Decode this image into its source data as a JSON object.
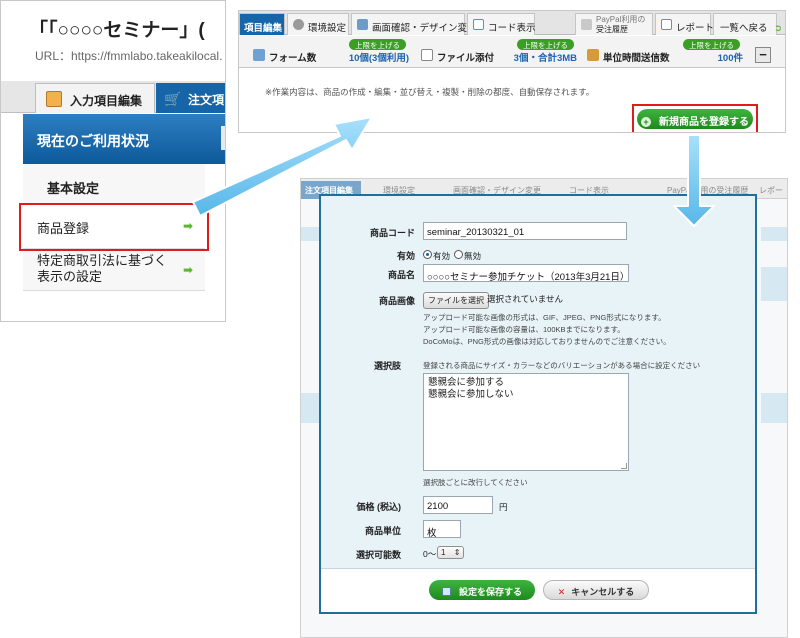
{
  "panel1": {
    "title": "「「○○○○セミナー」(",
    "url": "URL：https://fmmlabo.takeakilocal.",
    "tabs": {
      "input_edit": "入力項目編集",
      "order": "注文項"
    },
    "section_title": "現在のご利用状況",
    "menu": {
      "basic": "基本設定",
      "product": "商品登録",
      "law_line1": "特定商取引法に基づく",
      "law_line2": "表示の設定"
    },
    "arrow_glyph": "➡"
  },
  "panel2": {
    "tabs": {
      "input_edit": "項目編集",
      "env": "環境設定",
      "design": "画面確認・デザイン変更",
      "code": "コード表示",
      "paypal_line1": "PayPal利用の",
      "paypal_line2": "受注履歴",
      "report": "レポート",
      "back": "一覧へ戻る"
    },
    "upgrade_label": "上限を上げる",
    "stats": {
      "forms_label": "フォーム数",
      "forms_value": "10個(3個利用)",
      "files_label": "ファイル添付",
      "files_value": "3個・合計3MB",
      "rate_label": "単位時間送信数",
      "rate_value": "100件"
    },
    "collapse_label": "−",
    "autosave_note": "※作業内容は、商品の作成・編集・並び替え・複製・削除の都度、自動保存されます。",
    "new_product_button": "新規商品を登録する"
  },
  "panel3_bg": {
    "tabs": {
      "input_edit": "注文項目編集",
      "env": "環境設定",
      "design": "画面確認・デザイン変更",
      "code": "コード表示",
      "paypal": "PayPal利用の受注履歴",
      "report": "レポー"
    }
  },
  "form": {
    "code_label": "商品コード",
    "code_value": "seminar_20130321_01",
    "enabled_label": "有効",
    "enabled_on": "有効",
    "enabled_off": "無効",
    "enabled_selected": "有効",
    "name_label": "商品名",
    "name_value": "○○○○セミナー参加チケット（2013年3月21日）",
    "image_label": "商品画像",
    "file_button": "ファイルを選択",
    "file_status": "選択されていません",
    "image_notes": [
      "アップロード可能な画像の形式は、GIF、JPEG、PNG形式になります。",
      "アップロード可能な画像の容量は、100KBまでになります。",
      "DoCoMoは、PNG形式の画像は対応しておりませんのでご注意ください。"
    ],
    "options_label": "選択肢",
    "options_help": "登録される商品にサイズ・カラーなどのバリエーションがある場合に設定ください",
    "options_lines": [
      "懇親会に参加する",
      "懇親会に参加しない"
    ],
    "options_footer": "選択肢ごとに改行してください",
    "price_label": "価格 (税込)",
    "price_value": "2100",
    "price_unit": "円",
    "unit_label": "商品単位",
    "unit_value": "枚",
    "qty_label": "選択可能数",
    "qty_prefix": "0〜",
    "qty_value": "1",
    "save_button": "設定を保存する",
    "cancel_button": "キャンセルする"
  },
  "colors": {
    "accent_blue": "#1565a8",
    "green_button": "#2a9d2a",
    "highlight_red": "#e01b1b",
    "arrow_blue": "#57b7e8"
  }
}
